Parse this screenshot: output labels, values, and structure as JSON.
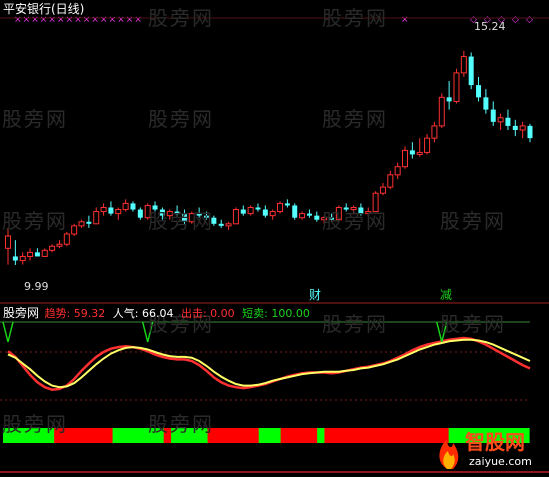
{
  "top": {
    "title": "平安银行(日线)",
    "high_label": "15.24",
    "low_label": "9.99",
    "mark_cai": "财",
    "mark_jian": "减"
  },
  "indicator": {
    "name": "股旁网",
    "items": [
      {
        "label": "趋势:",
        "value": "59.32",
        "color": "#ff3030"
      },
      {
        "label": "人气:",
        "value": "66.04",
        "color": "#ffffff"
      },
      {
        "label": "出击:",
        "value": "0.00",
        "color": "#ff3030"
      },
      {
        "label": "短卖:",
        "value": "100.00",
        "color": "#19d419"
      }
    ]
  },
  "watermark": "股旁网",
  "logo": {
    "name": "智股网",
    "url": "zaiyue.com"
  },
  "colors": {
    "up": "#ff3030",
    "down": "#54ffff",
    "trend": "#ff3030",
    "mood": "#ffff66"
  },
  "chart_data": {
    "type": "candlestick",
    "ylim": [
      9.5,
      15.8
    ],
    "candles": [
      [
        10.4,
        10.9,
        10.0,
        10.7
      ],
      [
        10.2,
        10.6,
        9.99,
        10.1
      ],
      [
        10.1,
        10.3,
        10.0,
        10.2
      ],
      [
        10.2,
        10.4,
        10.1,
        10.3
      ],
      [
        10.3,
        10.4,
        10.2,
        10.2
      ],
      [
        10.2,
        10.4,
        10.2,
        10.35
      ],
      [
        10.35,
        10.5,
        10.3,
        10.45
      ],
      [
        10.45,
        10.6,
        10.4,
        10.5
      ],
      [
        10.5,
        10.8,
        10.45,
        10.75
      ],
      [
        10.75,
        11.0,
        10.7,
        10.95
      ],
      [
        10.95,
        11.1,
        10.9,
        11.05
      ],
      [
        11.05,
        11.2,
        10.9,
        11.0
      ],
      [
        11.0,
        11.4,
        11.0,
        11.3
      ],
      [
        11.3,
        11.5,
        11.2,
        11.4
      ],
      [
        11.4,
        11.55,
        11.2,
        11.25
      ],
      [
        11.25,
        11.4,
        11.1,
        11.35
      ],
      [
        11.35,
        11.6,
        11.3,
        11.5
      ],
      [
        11.5,
        11.55,
        11.3,
        11.35
      ],
      [
        11.35,
        11.4,
        11.1,
        11.15
      ],
      [
        11.15,
        11.5,
        11.1,
        11.45
      ],
      [
        11.45,
        11.55,
        11.3,
        11.35
      ],
      [
        11.35,
        11.4,
        11.1,
        11.2
      ],
      [
        11.2,
        11.35,
        11.1,
        11.3
      ],
      [
        11.3,
        11.45,
        11.2,
        11.25
      ],
      [
        11.25,
        11.35,
        11.0,
        11.05
      ],
      [
        11.05,
        11.3,
        11.0,
        11.25
      ],
      [
        11.25,
        11.4,
        11.15,
        11.2
      ],
      [
        11.2,
        11.3,
        11.1,
        11.15
      ],
      [
        11.15,
        11.2,
        10.95,
        11.0
      ],
      [
        11.0,
        11.1,
        10.9,
        10.95
      ],
      [
        10.95,
        11.05,
        10.85,
        11.0
      ],
      [
        11.0,
        11.4,
        11.0,
        11.35
      ],
      [
        11.35,
        11.45,
        11.2,
        11.25
      ],
      [
        11.25,
        11.45,
        11.2,
        11.4
      ],
      [
        11.4,
        11.5,
        11.3,
        11.35
      ],
      [
        11.35,
        11.45,
        11.15,
        11.2
      ],
      [
        11.2,
        11.35,
        11.1,
        11.3
      ],
      [
        11.3,
        11.55,
        11.25,
        11.5
      ],
      [
        11.5,
        11.6,
        11.4,
        11.45
      ],
      [
        11.45,
        11.5,
        11.1,
        11.15
      ],
      [
        11.15,
        11.3,
        11.1,
        11.25
      ],
      [
        11.25,
        11.35,
        11.15,
        11.2
      ],
      [
        11.2,
        11.3,
        11.05,
        11.1
      ],
      [
        11.1,
        11.2,
        11.0,
        11.15
      ],
      [
        11.15,
        11.25,
        11.05,
        11.1
      ],
      [
        11.1,
        11.45,
        11.1,
        11.4
      ],
      [
        11.4,
        11.5,
        11.3,
        11.35
      ],
      [
        11.35,
        11.45,
        11.25,
        11.4
      ],
      [
        11.4,
        11.5,
        11.2,
        11.25
      ],
      [
        11.25,
        11.4,
        11.2,
        11.3
      ],
      [
        11.3,
        11.8,
        11.3,
        11.75
      ],
      [
        11.75,
        12.0,
        11.7,
        11.9
      ],
      [
        11.9,
        12.3,
        11.85,
        12.2
      ],
      [
        12.2,
        12.5,
        12.1,
        12.4
      ],
      [
        12.4,
        12.9,
        12.35,
        12.8
      ],
      [
        12.8,
        13.0,
        12.6,
        12.7
      ],
      [
        12.7,
        13.1,
        12.65,
        12.75
      ],
      [
        12.75,
        13.2,
        12.7,
        13.1
      ],
      [
        13.1,
        13.5,
        13.0,
        13.4
      ],
      [
        13.4,
        14.2,
        13.35,
        14.1
      ],
      [
        14.1,
        14.5,
        13.8,
        14.0
      ],
      [
        14.0,
        14.8,
        13.95,
        14.7
      ],
      [
        14.7,
        15.24,
        14.6,
        15.1
      ],
      [
        15.1,
        15.2,
        14.3,
        14.4
      ],
      [
        14.4,
        14.6,
        14.0,
        14.1
      ],
      [
        14.1,
        14.3,
        13.7,
        13.8
      ],
      [
        13.8,
        14.0,
        13.4,
        13.5
      ],
      [
        13.5,
        13.7,
        13.3,
        13.6
      ],
      [
        13.6,
        13.8,
        13.3,
        13.4
      ],
      [
        13.4,
        13.55,
        13.15,
        13.3
      ],
      [
        13.3,
        13.5,
        13.1,
        13.4
      ],
      [
        13.4,
        13.45,
        13.0,
        13.1
      ]
    ],
    "trend": [
      62,
      55,
      44,
      33,
      24,
      18,
      15,
      16,
      20,
      28,
      38,
      47,
      55,
      61,
      65,
      67,
      68,
      67,
      65,
      62,
      58,
      55,
      53,
      52,
      52,
      50,
      45,
      38,
      30,
      24,
      20,
      18,
      17,
      18,
      20,
      22,
      25,
      28,
      31,
      33,
      35,
      36,
      36,
      36,
      35,
      36,
      38,
      40,
      42,
      43,
      45,
      47,
      50,
      54,
      58,
      63,
      67,
      70,
      72,
      74,
      76,
      77,
      78,
      77,
      74,
      70,
      65,
      60,
      55,
      50,
      45,
      41
    ],
    "mood": [
      58,
      54,
      47,
      40,
      32,
      25,
      20,
      18,
      19,
      23,
      30,
      38,
      46,
      53,
      59,
      63,
      66,
      67,
      66,
      64,
      61,
      58,
      56,
      55,
      55,
      54,
      50,
      44,
      37,
      31,
      26,
      22,
      20,
      20,
      21,
      23,
      26,
      28,
      30,
      32,
      34,
      35,
      36,
      37,
      37,
      37,
      38,
      39,
      41,
      42,
      44,
      46,
      49,
      52,
      56,
      60,
      64,
      67,
      70,
      72,
      74,
      75,
      76,
      76,
      75,
      73,
      70,
      66,
      62,
      58,
      54,
      50
    ],
    "signal_markers": [
      0,
      19,
      59
    ],
    "band": [
      "g",
      "g",
      "g",
      "g",
      "g",
      "g",
      "g",
      "r",
      "r",
      "r",
      "r",
      "r",
      "r",
      "r",
      "r",
      "g",
      "g",
      "g",
      "g",
      "g",
      "g",
      "g",
      "r",
      "g",
      "g",
      "g",
      "g",
      "g",
      "r",
      "r",
      "r",
      "r",
      "r",
      "r",
      "r",
      "g",
      "g",
      "g",
      "r",
      "r",
      "r",
      "r",
      "r",
      "g",
      "r",
      "r",
      "r",
      "r",
      "r",
      "r",
      "r",
      "r",
      "r",
      "r",
      "r",
      "r",
      "r",
      "r",
      "r",
      "r",
      "r",
      "g",
      "g",
      "g",
      "g",
      "g",
      "g",
      "g",
      "g",
      "g",
      "g",
      "g"
    ]
  }
}
